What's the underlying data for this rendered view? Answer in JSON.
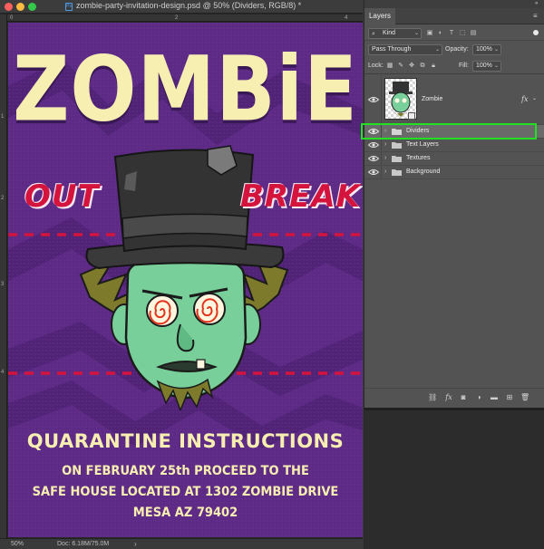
{
  "window": {
    "title": "zombie-party-invitation-design.psd @ 50% (Dividers, RGB/8) *",
    "doc_icon": "Ps"
  },
  "rulers": {
    "top": [
      "0",
      "2",
      "4"
    ],
    "left": [
      "1",
      "2",
      "3",
      "4"
    ]
  },
  "poster": {
    "title": "ZOMBiE",
    "out": "OUT",
    "break": "BREAK",
    "heading": "QUARANTINE INSTRUCTIONS",
    "line1": "ON FEBRUARY 25th PROCEED TO THE",
    "line2": "SAFE HOUSE LOCATED AT 1302 ZOMBIE DRIVE",
    "line3": "MESA AZ 79402",
    "colors": {
      "background": "#5d2a85",
      "title": "#f7eeb1",
      "accent_red": "#d4143c",
      "zombie_skin": "#79cf9a"
    }
  },
  "status_bar": {
    "zoom": "50%",
    "doc": "Doc: 6.18M/75.0M",
    "arrow": "›"
  },
  "layers_panel": {
    "tab": "Layers",
    "filter": {
      "kind_label": "Kind",
      "toggle_icon": "filter-toggle"
    },
    "blend_mode": "Pass Through",
    "opacity_label": "Opacity:",
    "opacity_value": "100%",
    "lock_label": "Lock:",
    "fill_label": "Fill:",
    "fill_value": "100%",
    "layers": [
      {
        "name": "Zombie",
        "type": "smart-object",
        "visible": true,
        "fx": "fx"
      },
      {
        "name": "Dividers",
        "type": "group",
        "visible": true,
        "selected": true
      },
      {
        "name": "Text Layers",
        "type": "group",
        "visible": true
      },
      {
        "name": "Textures",
        "type": "group",
        "visible": true
      },
      {
        "name": "Background",
        "type": "group",
        "visible": true
      }
    ],
    "highlight_color": "#22e022",
    "footer_icons": [
      "link-icon",
      "fx-icon",
      "mask-icon",
      "adjustment-icon",
      "folder-icon",
      "new-layer-icon",
      "trash-icon"
    ]
  }
}
